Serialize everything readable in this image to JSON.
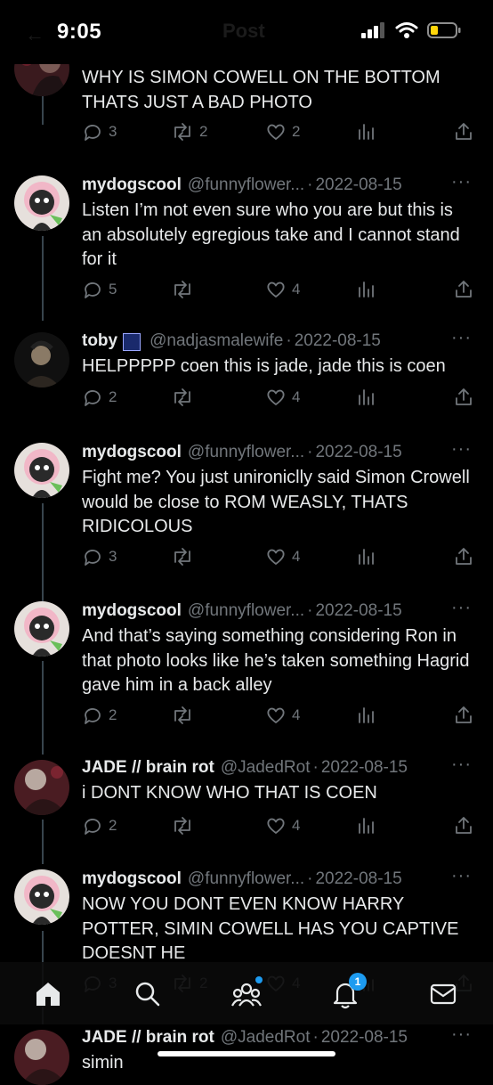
{
  "status_bar": {
    "time": "9:05",
    "ghost_title": "Post"
  },
  "tweets": [
    {
      "name": "",
      "handle": "",
      "date": "",
      "text": "WHY IS SIMON COWELL ON THE BOTTOM THATS JUST A BAD PHOTO",
      "replies": "3",
      "reposts": "2",
      "likes": "2",
      "avatar": "concert-photo"
    },
    {
      "name": "mydogscool",
      "handle": "@funnyflower...",
      "date": "2022-08-15",
      "text": "Listen I’m not even sure who you are but this is an absolutely egregious take and I cannot stand for it",
      "replies": "5",
      "reposts": "",
      "likes": "4",
      "avatar": "cat-flower"
    },
    {
      "name": "toby",
      "handle": "@nadjasmalewife",
      "date": "2022-08-15",
      "text": "HELPPPPP coen this is jade, jade this is coen",
      "replies": "2",
      "reposts": "",
      "likes": "4",
      "avatar": "dark-portrait"
    },
    {
      "name": "mydogscool",
      "handle": "@funnyflower...",
      "date": "2022-08-15",
      "text": "Fight me? You just unironiclly said Simon Crowell would be close to ROM WEASLY, THATS RIDICOLOUS",
      "replies": "3",
      "reposts": "",
      "likes": "4",
      "avatar": "cat-flower"
    },
    {
      "name": "mydogscool",
      "handle": "@funnyflower...",
      "date": "2022-08-15",
      "text": "And that’s saying something considering Ron in that photo looks like he’s taken something Hagrid gave him in a back alley",
      "replies": "2",
      "reposts": "",
      "likes": "4",
      "avatar": "cat-flower"
    },
    {
      "name": "JADE // brain rot",
      "handle": "@JadedRot",
      "date": "2022-08-15",
      "text": "i DONT KNOW WHO THAT IS COEN",
      "replies": "2",
      "reposts": "",
      "likes": "4",
      "avatar": "concert-photo"
    },
    {
      "name": "mydogscool",
      "handle": "@funnyflower...",
      "date": "2022-08-15",
      "text": "NOW YOU DONT EVEN KNOW HARRY POTTER, SIMIN COWELL HAS YOU CAPTIVE DOESNT HE",
      "replies": "3",
      "reposts": "2",
      "likes": "4",
      "avatar": "cat-flower"
    },
    {
      "name": "JADE // brain rot",
      "handle": "@JadedRot",
      "date": "2022-08-15",
      "text": "simin",
      "replies": "",
      "reposts": "",
      "likes": "",
      "avatar": "concert-photo"
    }
  ],
  "nav": {
    "items": [
      "home-icon",
      "search-icon",
      "communities-icon",
      "notifications-icon",
      "messages-icon"
    ],
    "notification_count": "1"
  },
  "colors": {
    "background": "#000000",
    "text": "#e7e9ea",
    "muted": "#71767b",
    "accent": "#1d9bf0"
  }
}
